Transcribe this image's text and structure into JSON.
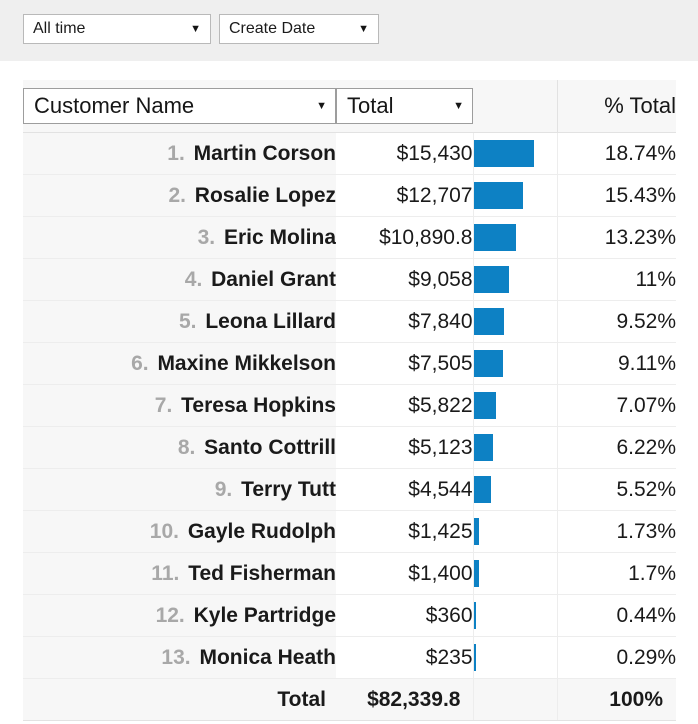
{
  "toolbar": {
    "filters": [
      {
        "name": "time-range-select",
        "value": "All time",
        "caret": "chevron-down-icon"
      },
      {
        "name": "date-field-select",
        "value": "Create Date",
        "caret": "chevron-down-icon"
      }
    ]
  },
  "table": {
    "columns": {
      "name_header": "Customer Name",
      "value_header": "Total",
      "bar_header": "",
      "percent_header": "% Total"
    },
    "total_row": {
      "label": "Total",
      "value": "$82,339.8",
      "percent": "100%"
    },
    "rows": [
      {
        "rank": "1.",
        "name": "Martin Corson",
        "value": "$15,430",
        "percent": "18.74%",
        "bar_pct": 18.74
      },
      {
        "rank": "2.",
        "name": "Rosalie Lopez",
        "value": "$12,707",
        "percent": "15.43%",
        "bar_pct": 15.43
      },
      {
        "rank": "3.",
        "name": "Eric Molina",
        "value": "$10,890.8",
        "percent": "13.23%",
        "bar_pct": 13.23
      },
      {
        "rank": "4.",
        "name": "Daniel Grant",
        "value": "$9,058",
        "percent": "11%",
        "bar_pct": 11.0
      },
      {
        "rank": "5.",
        "name": "Leona Lillard",
        "value": "$7,840",
        "percent": "9.52%",
        "bar_pct": 9.52
      },
      {
        "rank": "6.",
        "name": "Maxine Mikkelson",
        "value": "$7,505",
        "percent": "9.11%",
        "bar_pct": 9.11
      },
      {
        "rank": "7.",
        "name": "Teresa Hopkins",
        "value": "$5,822",
        "percent": "7.07%",
        "bar_pct": 7.07
      },
      {
        "rank": "8.",
        "name": "Santo Cottrill",
        "value": "$5,123",
        "percent": "6.22%",
        "bar_pct": 6.22
      },
      {
        "rank": "9.",
        "name": "Terry Tutt",
        "value": "$4,544",
        "percent": "5.52%",
        "bar_pct": 5.52
      },
      {
        "rank": "10.",
        "name": "Gayle Rudolph",
        "value": "$1,425",
        "percent": "1.73%",
        "bar_pct": 1.73
      },
      {
        "rank": "11.",
        "name": "Ted Fisherman",
        "value": "$1,400",
        "percent": "1.7%",
        "bar_pct": 1.7
      },
      {
        "rank": "12.",
        "name": "Kyle Partridge",
        "value": "$360",
        "percent": "0.44%",
        "bar_pct": 0.44
      },
      {
        "rank": "13.",
        "name": "Monica Heath",
        "value": "$235",
        "percent": "0.29%",
        "bar_pct": 0.29
      }
    ]
  },
  "chart_data": {
    "type": "bar",
    "title": "Customer Name by Total",
    "xlabel": "Total",
    "ylabel": "Customer Name",
    "categories": [
      "Martin Corson",
      "Rosalie Lopez",
      "Eric Molina",
      "Daniel Grant",
      "Leona Lillard",
      "Maxine Mikkelson",
      "Teresa Hopkins",
      "Santo Cottrill",
      "Terry Tutt",
      "Gayle Rudolph",
      "Ted Fisherman",
      "Kyle Partridge",
      "Monica Heath"
    ],
    "values": [
      15430,
      12707,
      10890.8,
      9058,
      7840,
      7505,
      5822,
      5123,
      4544,
      1425,
      1400,
      360,
      235
    ],
    "percent_of_total": [
      18.74,
      15.43,
      13.23,
      11,
      9.52,
      9.11,
      7.07,
      6.22,
      5.52,
      1.73,
      1.7,
      0.44,
      0.29
    ],
    "total": 82339.8,
    "total_percent": 100,
    "bar_color": "#0d81c4",
    "orientation": "horizontal",
    "grid": false,
    "legend": false,
    "xlim": [
      0,
      15430
    ]
  }
}
